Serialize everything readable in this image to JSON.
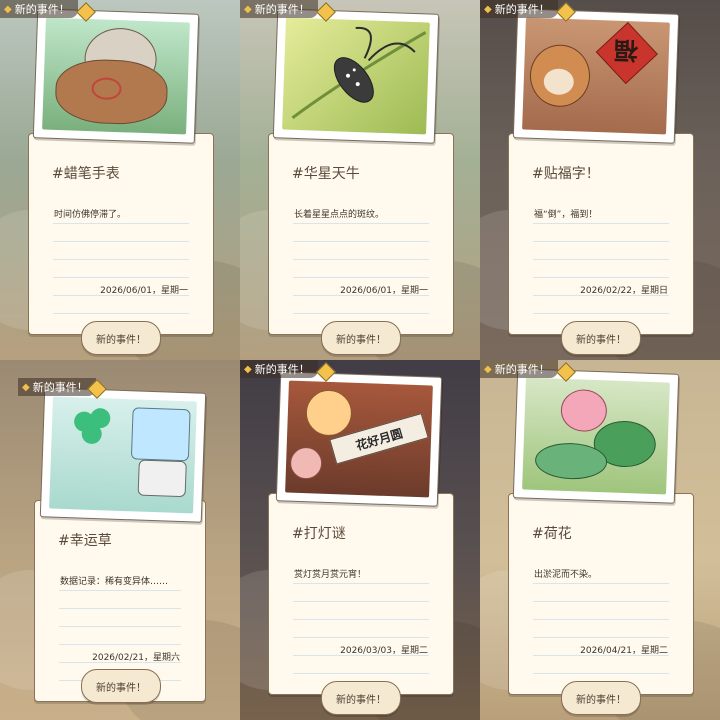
{
  "cards": [
    {
      "header": "新的事件！",
      "title": "#蜡笔手表",
      "desc": "时间仿佛停滞了。",
      "date": "2026/06/01，星期一",
      "button": "新的事件！"
    },
    {
      "header": "新的事件！",
      "title": "#华星天牛",
      "desc": "长着星星点点的斑纹。",
      "date": "2026/06/01，星期一",
      "button": "新的事件！"
    },
    {
      "header": "新的事件！",
      "title": "#贴福字！",
      "desc": "福“倒”，福到！",
      "date": "2026/02/22，星期日",
      "button": "新的事件！"
    },
    {
      "header": "新的事件！",
      "title": "#幸运草",
      "desc": "数据记录：稀有变异体……",
      "date": "2026/02/21，星期六",
      "button": "新的事件！"
    },
    {
      "header": "新的事件！",
      "title": "#打灯谜",
      "desc": "赏灯赏月赏元宵！",
      "date": "2026/03/03，星期二",
      "button": "新的事件！"
    },
    {
      "header": "新的事件！",
      "title": "#荷花",
      "desc": "出淤泥而不染。",
      "date": "2026/04/21，星期二",
      "button": "新的事件！"
    }
  ],
  "illustration_text": {
    "fu": "福",
    "lantern_riddle": "花好月圆"
  },
  "icons": {
    "header": "diamond-icon"
  },
  "colors": {
    "note_bg": "#fffaed",
    "button_bg": "#f5e9d2",
    "pin": "#f2c24a"
  }
}
